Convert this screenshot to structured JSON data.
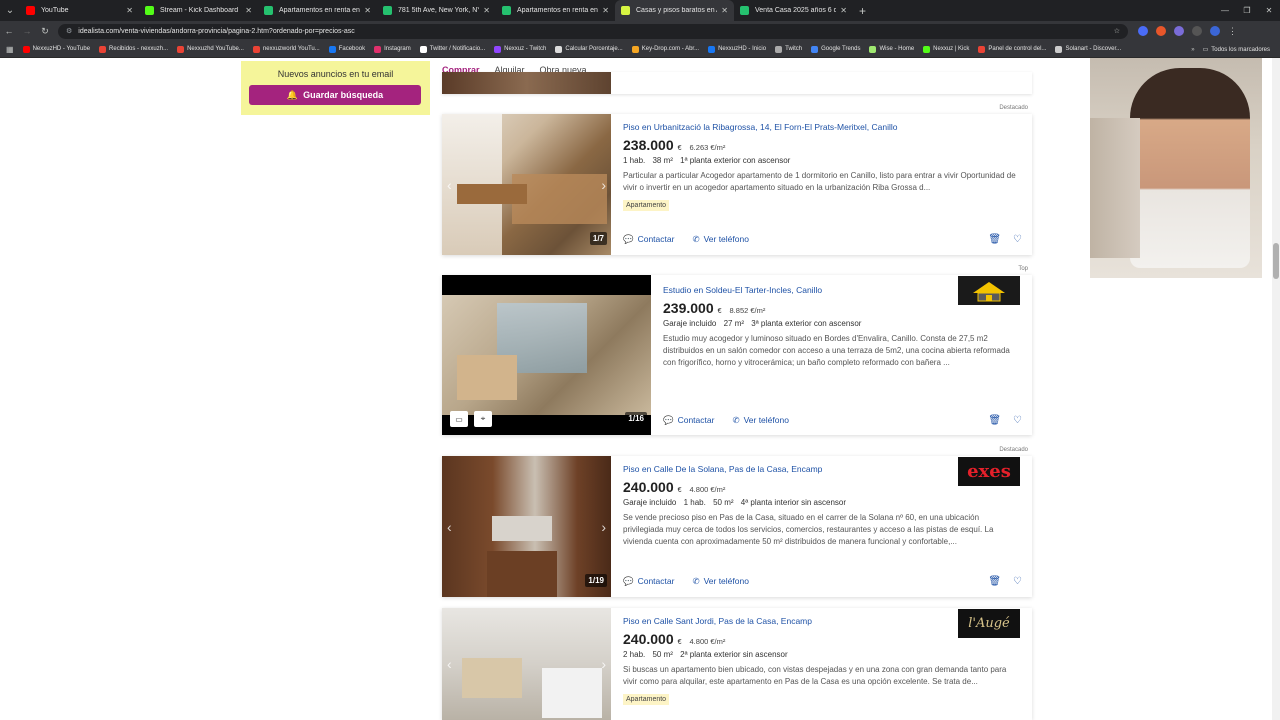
{
  "browser": {
    "tabs": [
      {
        "label": "YouTube",
        "color": "#ff0000",
        "active": false
      },
      {
        "label": "Stream - Kick Dashboard",
        "color": "#53fc18",
        "active": false
      },
      {
        "label": "Apartamentos en renta en New",
        "color": "#25c16f",
        "active": false
      },
      {
        "label": "781 5th Ave, New York, NY 100",
        "color": "#25c16f",
        "active": false
      },
      {
        "label": "Apartamentos en renta en Las",
        "color": "#25c16f",
        "active": false
      },
      {
        "label": "Casas y pisos baratos en Andor",
        "color": "#d7f542",
        "active": true
      },
      {
        "label": "Venta Casa 2025 años 6 dormit",
        "color": "#25c16f",
        "active": false
      }
    ],
    "url": "idealista.com/venta-viviendas/andorra-provincia/pagina-2.htm?ordenado-por=precios-asc",
    "bookmarks": [
      {
        "label": "NexxuzHD - YouTube",
        "color": "#ff0000"
      },
      {
        "label": "Recibidos - nexxuzh...",
        "color": "#ea4335"
      },
      {
        "label": "Nexxuzhd YouTube...",
        "color": "#ea4335"
      },
      {
        "label": "nexxuzworld YouTu...",
        "color": "#ea4335"
      },
      {
        "label": "Facebook",
        "color": "#1877f2"
      },
      {
        "label": "Instagram",
        "color": "#e1306c"
      },
      {
        "label": "Twitter / Notificacio...",
        "color": "#ffffff"
      },
      {
        "label": "Nexxuz - Twitch",
        "color": "#9146ff"
      },
      {
        "label": "Calcular Porcentaje...",
        "color": "#dddddd"
      },
      {
        "label": "Key-Drop.com - Abr...",
        "color": "#f5a623"
      },
      {
        "label": "NexxuzHD - Inicio",
        "color": "#1877f2"
      },
      {
        "label": "Twitch",
        "color": "#aaaaaa"
      },
      {
        "label": "Google Trends",
        "color": "#4285f4"
      },
      {
        "label": "Wise - Home",
        "color": "#9fe870"
      },
      {
        "label": "Nexxuz | Kick",
        "color": "#53fc18"
      },
      {
        "label": "Panel de control del...",
        "color": "#ea4335"
      },
      {
        "label": "Solanart - Discover...",
        "color": "#cccccc"
      }
    ],
    "bookmarks_all": "Todos los marcadores"
  },
  "alert": {
    "title": "Nuevos anuncios en tu email",
    "save_button": "Guardar búsqueda"
  },
  "tabs": [
    {
      "label": "Comprar",
      "active": true
    },
    {
      "label": "Alquilar",
      "active": false
    },
    {
      "label": "Obra nueva",
      "active": false
    }
  ],
  "listings": [
    {
      "label_top": "Destacado",
      "title": "Piso en Urbanització la Ribagrossa, 14, El Forn-El Prats-Meritxel, Canillo",
      "price": "238.000",
      "currency": "€",
      "ppm": "6.263 €/m²",
      "details": [
        "1 hab.",
        "38 m²",
        "1ª planta exterior con ascensor"
      ],
      "desc": "Particular a particular Acogedor apartamento de 1 dormitorio en Canillo, listo para entrar a vivir Oportunidad de vivir o invertir en un acogedor apartamento situado en la urbanización Riba Grossa d...",
      "tag": "Apartamento",
      "counter": "1/7",
      "contact": "Contactar",
      "phone": "Ver teléfono"
    },
    {
      "label_top": "Top",
      "title": "Estudio en Soldeu-El Tarter-Incles, Canillo",
      "price": "239.000",
      "currency": "€",
      "ppm": "8.852 €/m²",
      "details": [
        "Garaje incluido",
        "27 m²",
        "3ª planta exterior con ascensor"
      ],
      "desc": "Estudio muy acogedor y luminoso situado en Bordes d'Envalira, Canillo. Consta de 27,5 m2 distribuidos en un salón comedor con acceso a una terraza de 5m2, una cocina abierta reformada con frigorífico, horno y vitrocerámica; un baño completo reformado con bañera ...",
      "tag": "",
      "counter": "1/16",
      "contact": "Contactar",
      "phone": "Ver teléfono"
    },
    {
      "label_top": "Destacado",
      "title": "Piso en Calle De la Solana, Pas de la Casa, Encamp",
      "price": "240.000",
      "currency": "€",
      "ppm": "4.800 €/m²",
      "details": [
        "Garaje incluido",
        "1 hab.",
        "50 m²",
        "4ª planta interior sin ascensor"
      ],
      "desc": "Se vende precioso piso en Pas de la Casa, situado en el carrer de la Solana nº 60, en una ubicación privilegiada muy cerca de todos los servicios, comercios, restaurantes y acceso a las pistas de esquí. La vivienda cuenta con aproximadamente 50 m² distribuidos de manera funcional y confortable,...",
      "tag": "",
      "counter": "1/19",
      "contact": "Contactar",
      "phone": "Ver teléfono",
      "logo_text": "exes"
    },
    {
      "label_top": "",
      "title": "Piso en Calle Sant Jordi, Pas de la Casa, Encamp",
      "price": "240.000",
      "currency": "€",
      "ppm": "4.800 €/m²",
      "details": [
        "2 hab.",
        "50 m²",
        "2ª planta exterior sin ascensor"
      ],
      "desc": "Si buscas un apartamento bien ubicado, con vistas despejadas y en una zona con gran demanda tanto para vivir como para alquilar, este apartamento en Pas de la Casa es una opción excelente. Se trata de...",
      "tag": "Apartamento",
      "logo_text": "l'Augé"
    }
  ]
}
